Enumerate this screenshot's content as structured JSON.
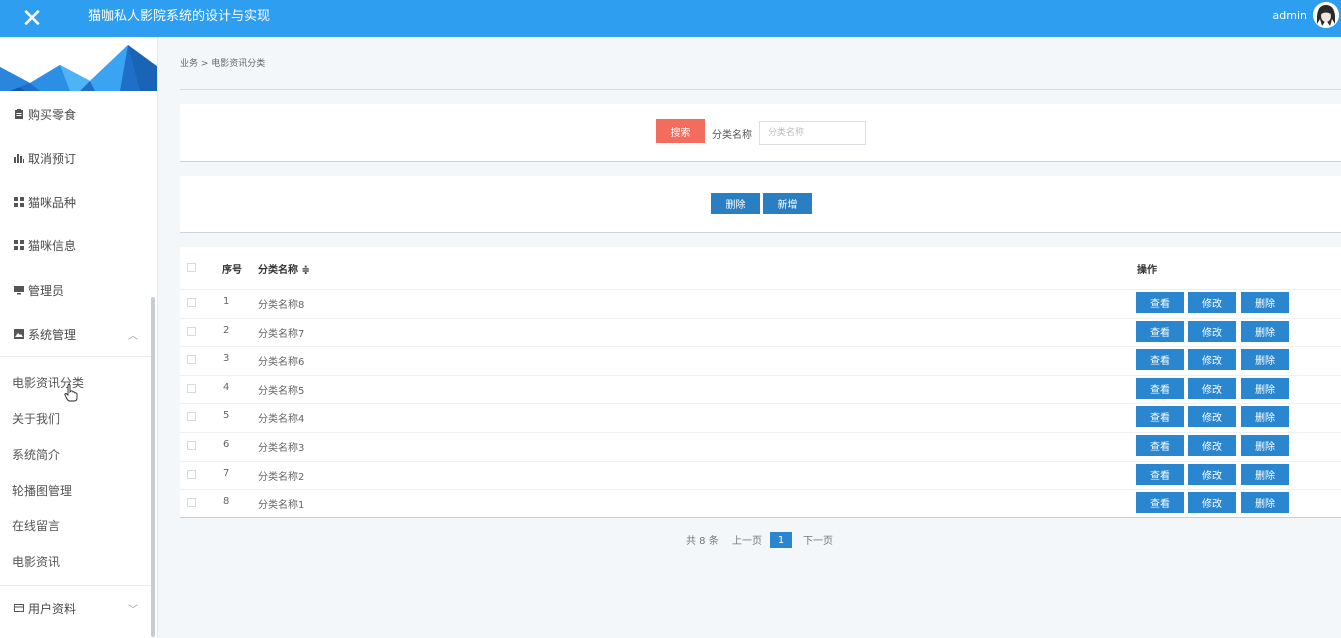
{
  "header": {
    "title": "猫咖私人影院系统的设计与实现",
    "user": "admin"
  },
  "sidebar": {
    "items": [
      {
        "label": "购买零食",
        "icon": "clipboard-icon"
      },
      {
        "label": "取消预订",
        "icon": "bar-chart-icon"
      },
      {
        "label": "猫咪品种",
        "icon": "grid-icon"
      },
      {
        "label": "猫咪信息",
        "icon": "grid-icon"
      },
      {
        "label": "管理员",
        "icon": "monitor-icon"
      },
      {
        "label": "系统管理",
        "icon": "image-icon"
      }
    ],
    "sub_items": [
      "电影资讯分类",
      "关于我们",
      "系统简介",
      "轮播图管理",
      "在线留言",
      "电影资讯"
    ],
    "bottom_item": {
      "label": "用户资料",
      "icon": "card-icon"
    }
  },
  "breadcrumb": "业务 > 电影资讯分类",
  "search": {
    "button": "搜索",
    "label": "分类名称",
    "placeholder": "分类名称"
  },
  "actions": {
    "delete": "删除",
    "add": "新增"
  },
  "table": {
    "headers": {
      "index": "序号",
      "name": "分类名称 ≑",
      "ops": "操作"
    },
    "rows": [
      {
        "index": "1",
        "name": "分类名称8"
      },
      {
        "index": "2",
        "name": "分类名称7"
      },
      {
        "index": "3",
        "name": "分类名称6"
      },
      {
        "index": "4",
        "name": "分类名称5"
      },
      {
        "index": "5",
        "name": "分类名称4"
      },
      {
        "index": "6",
        "name": "分类名称3"
      },
      {
        "index": "7",
        "name": "分类名称2"
      },
      {
        "index": "8",
        "name": "分类名称1"
      }
    ],
    "row_actions": {
      "view": "查看",
      "edit": "修改",
      "delete": "删除"
    }
  },
  "pagination": {
    "total": "共 8 条",
    "prev": "上一页",
    "current": "1",
    "next": "下一页"
  },
  "colors": {
    "topbar": "#2e9ef0",
    "search_button": "#f36d5e",
    "action_button": "#2a87cf"
  }
}
